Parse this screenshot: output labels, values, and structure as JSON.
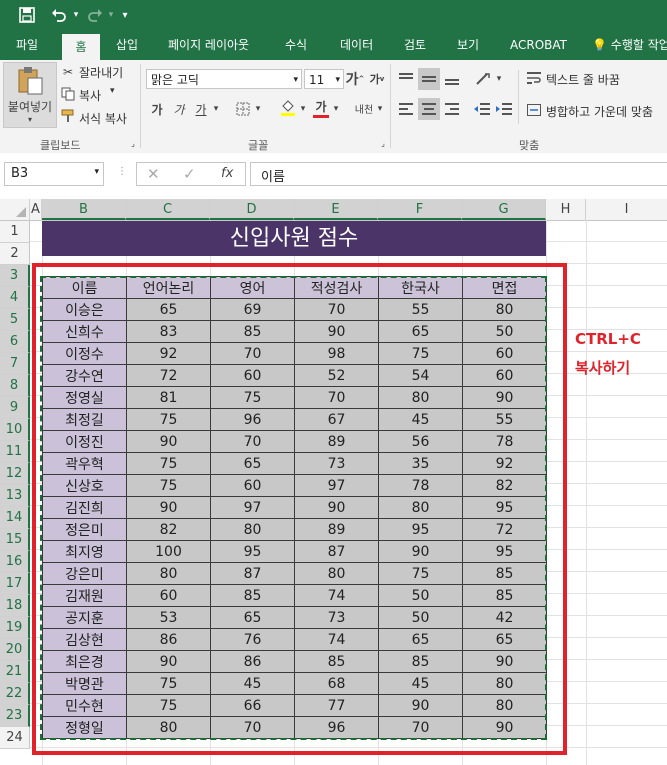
{
  "quick_access": {
    "save_icon": "save-icon",
    "undo_icon": "undo-icon",
    "redo_icon": "redo-icon",
    "customize_icon": "customize-icon"
  },
  "tabs": [
    {
      "label": "파일"
    },
    {
      "label": "홈"
    },
    {
      "label": "삽입"
    },
    {
      "label": "페이지 레이아웃"
    },
    {
      "label": "수식"
    },
    {
      "label": "데이터"
    },
    {
      "label": "검토"
    },
    {
      "label": "보기"
    },
    {
      "label": "ACROBAT"
    },
    {
      "label": "수행할 작업"
    }
  ],
  "ribbon": {
    "paste_label": "붙여넣기",
    "cut_label": "잘라내기",
    "copy_label": "복사",
    "format_painter_label": "서식 복사",
    "font_name": "맑은 고딕",
    "font_size": "11",
    "grow_font": "가",
    "shrink_font": "가",
    "bold": "가",
    "italic": "가",
    "underline": "가",
    "font_color": "가",
    "phonetic": "내천",
    "wrap_text_label": "텍스트 줄 바꿈",
    "merge_center_label": "병합하고 가운데 맞춤",
    "group_clipboard": "클립보드",
    "group_font": "글꼴",
    "group_alignment": "맞춤"
  },
  "formula_bar": {
    "name_box": "B3",
    "function_icon": "fx",
    "value": "이름"
  },
  "columns": [
    "A",
    "B",
    "C",
    "D",
    "E",
    "F",
    "G",
    "H",
    "I"
  ],
  "rows": [
    "1",
    "2",
    "3",
    "4",
    "5",
    "6",
    "7",
    "8",
    "9",
    "10",
    "11",
    "12",
    "13",
    "14",
    "15",
    "16",
    "17",
    "18",
    "19",
    "20",
    "21",
    "22",
    "23",
    "24"
  ],
  "sheet": {
    "title": "신입사원 점수",
    "headers": [
      "이름",
      "언어논리",
      "영어",
      "적성검사",
      "한국사",
      "면접"
    ],
    "records": [
      [
        "이승은",
        "65",
        "69",
        "70",
        "55",
        "80"
      ],
      [
        "신희수",
        "83",
        "85",
        "90",
        "65",
        "50"
      ],
      [
        "이정수",
        "92",
        "70",
        "98",
        "75",
        "60"
      ],
      [
        "강수연",
        "72",
        "60",
        "52",
        "54",
        "60"
      ],
      [
        "정영실",
        "81",
        "75",
        "70",
        "80",
        "90"
      ],
      [
        "최정길",
        "75",
        "96",
        "67",
        "45",
        "55"
      ],
      [
        "이정진",
        "90",
        "70",
        "89",
        "56",
        "78"
      ],
      [
        "곽우혁",
        "75",
        "65",
        "73",
        "35",
        "92"
      ],
      [
        "신상호",
        "75",
        "60",
        "97",
        "78",
        "82"
      ],
      [
        "김진희",
        "90",
        "97",
        "90",
        "80",
        "95"
      ],
      [
        "정은미",
        "82",
        "80",
        "89",
        "95",
        "72"
      ],
      [
        "최지영",
        "100",
        "95",
        "87",
        "90",
        "95"
      ],
      [
        "강은미",
        "80",
        "87",
        "80",
        "75",
        "85"
      ],
      [
        "김재원",
        "60",
        "85",
        "74",
        "50",
        "85"
      ],
      [
        "공지훈",
        "53",
        "65",
        "73",
        "50",
        "42"
      ],
      [
        "김상현",
        "86",
        "76",
        "74",
        "65",
        "65"
      ],
      [
        "최은경",
        "90",
        "86",
        "85",
        "85",
        "90"
      ],
      [
        "박명관",
        "75",
        "45",
        "68",
        "45",
        "80"
      ],
      [
        "민수현",
        "75",
        "66",
        "77",
        "90",
        "80"
      ],
      [
        "정형일",
        "80",
        "70",
        "96",
        "70",
        "90"
      ]
    ]
  },
  "annotation": {
    "line1": "CTRL+C",
    "line2": "복사하기",
    "color": "#e0232b"
  },
  "colors": {
    "excel_green": "#217346",
    "title_fill": "#4b3568",
    "header_fill": "#cdc3d8",
    "cell_fill": "#c8c8c8",
    "marquee": "#1a6e33"
  }
}
